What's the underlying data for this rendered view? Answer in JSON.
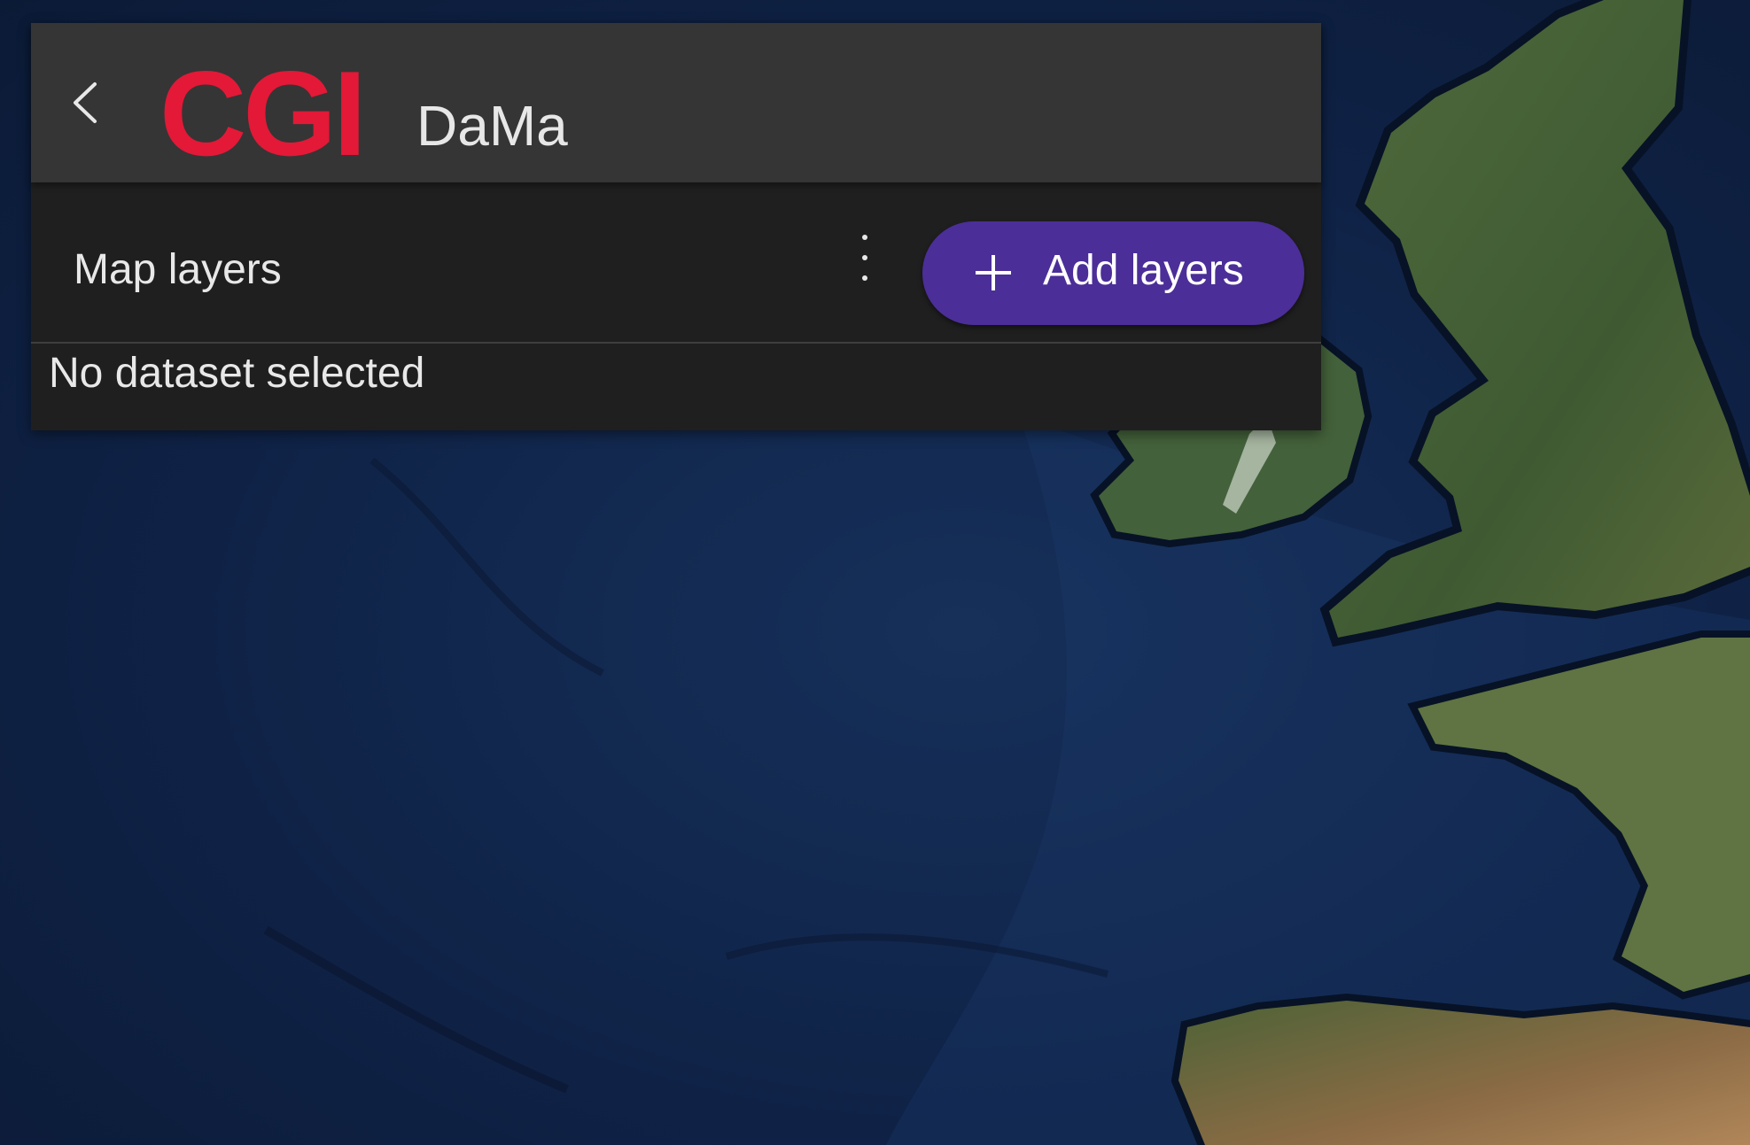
{
  "header": {
    "logo_text": "CGI",
    "app_title": "DaMa",
    "back_icon": "chevron-left-icon"
  },
  "layers_panel": {
    "title": "Map layers",
    "menu_icon": "more-vertical-icon",
    "add_button_label": "Add layers",
    "add_button_icon": "plus-icon",
    "empty_state": "No dataset selected"
  },
  "colors": {
    "logo": "#e31937",
    "accent": "#4b2e98",
    "header_bg": "#353535",
    "panel_bg": "#1f1f1f",
    "ocean": "#0f1f3a"
  },
  "map": {
    "base_layer": "satellite imagery"
  }
}
